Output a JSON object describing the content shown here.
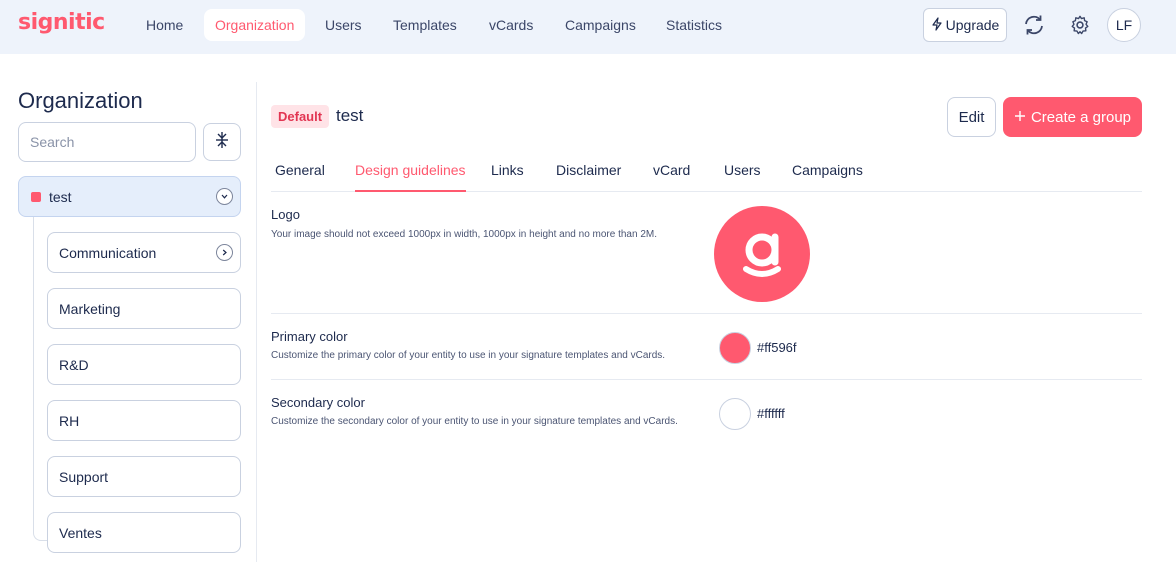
{
  "app": {
    "logo_text": "signitic"
  },
  "nav": {
    "items": [
      {
        "label": "Home"
      },
      {
        "label": "Organization"
      },
      {
        "label": "Users"
      },
      {
        "label": "Templates"
      },
      {
        "label": "vCards"
      },
      {
        "label": "Campaigns"
      },
      {
        "label": "Statistics"
      }
    ],
    "active": "Organization"
  },
  "toolbar": {
    "upgrade_label": "Upgrade",
    "avatar_initials": "LF",
    "icons": [
      "bolt-icon",
      "sync-icon",
      "gear-icon"
    ]
  },
  "sidebar": {
    "title": "Organization",
    "search_placeholder": "Search",
    "root": {
      "label": "test",
      "color": "#ff596f"
    },
    "children": [
      {
        "label": "Communication"
      },
      {
        "label": "Marketing"
      },
      {
        "label": "R&D"
      },
      {
        "label": "RH"
      },
      {
        "label": "Support"
      },
      {
        "label": "Ventes"
      }
    ]
  },
  "header": {
    "badge": "Default",
    "entity_name": "test",
    "edit_label": "Edit",
    "create_label": "Create a group"
  },
  "tabs": [
    {
      "label": "General"
    },
    {
      "label": "Design guidelines"
    },
    {
      "label": "Links"
    },
    {
      "label": "Disclaimer"
    },
    {
      "label": "vCard"
    },
    {
      "label": "Users"
    },
    {
      "label": "Campaigns"
    }
  ],
  "active_tab": "Design guidelines",
  "design": {
    "logo": {
      "title": "Logo",
      "description": "Your image should not exceed 1000px in width, 1000px in height and no more than 2M."
    },
    "primary": {
      "title": "Primary color",
      "description": "Customize the primary color of your entity to use in your signature templates and vCards.",
      "value": "#ff596f"
    },
    "secondary": {
      "title": "Secondary color",
      "description": "Customize the secondary color of your entity to use in your signature templates and vCards.",
      "value": "#ffffff"
    }
  },
  "colors": {
    "accent": "#ff596f",
    "text": "#1d2a4d",
    "topbar_bg": "#eef3fb"
  }
}
